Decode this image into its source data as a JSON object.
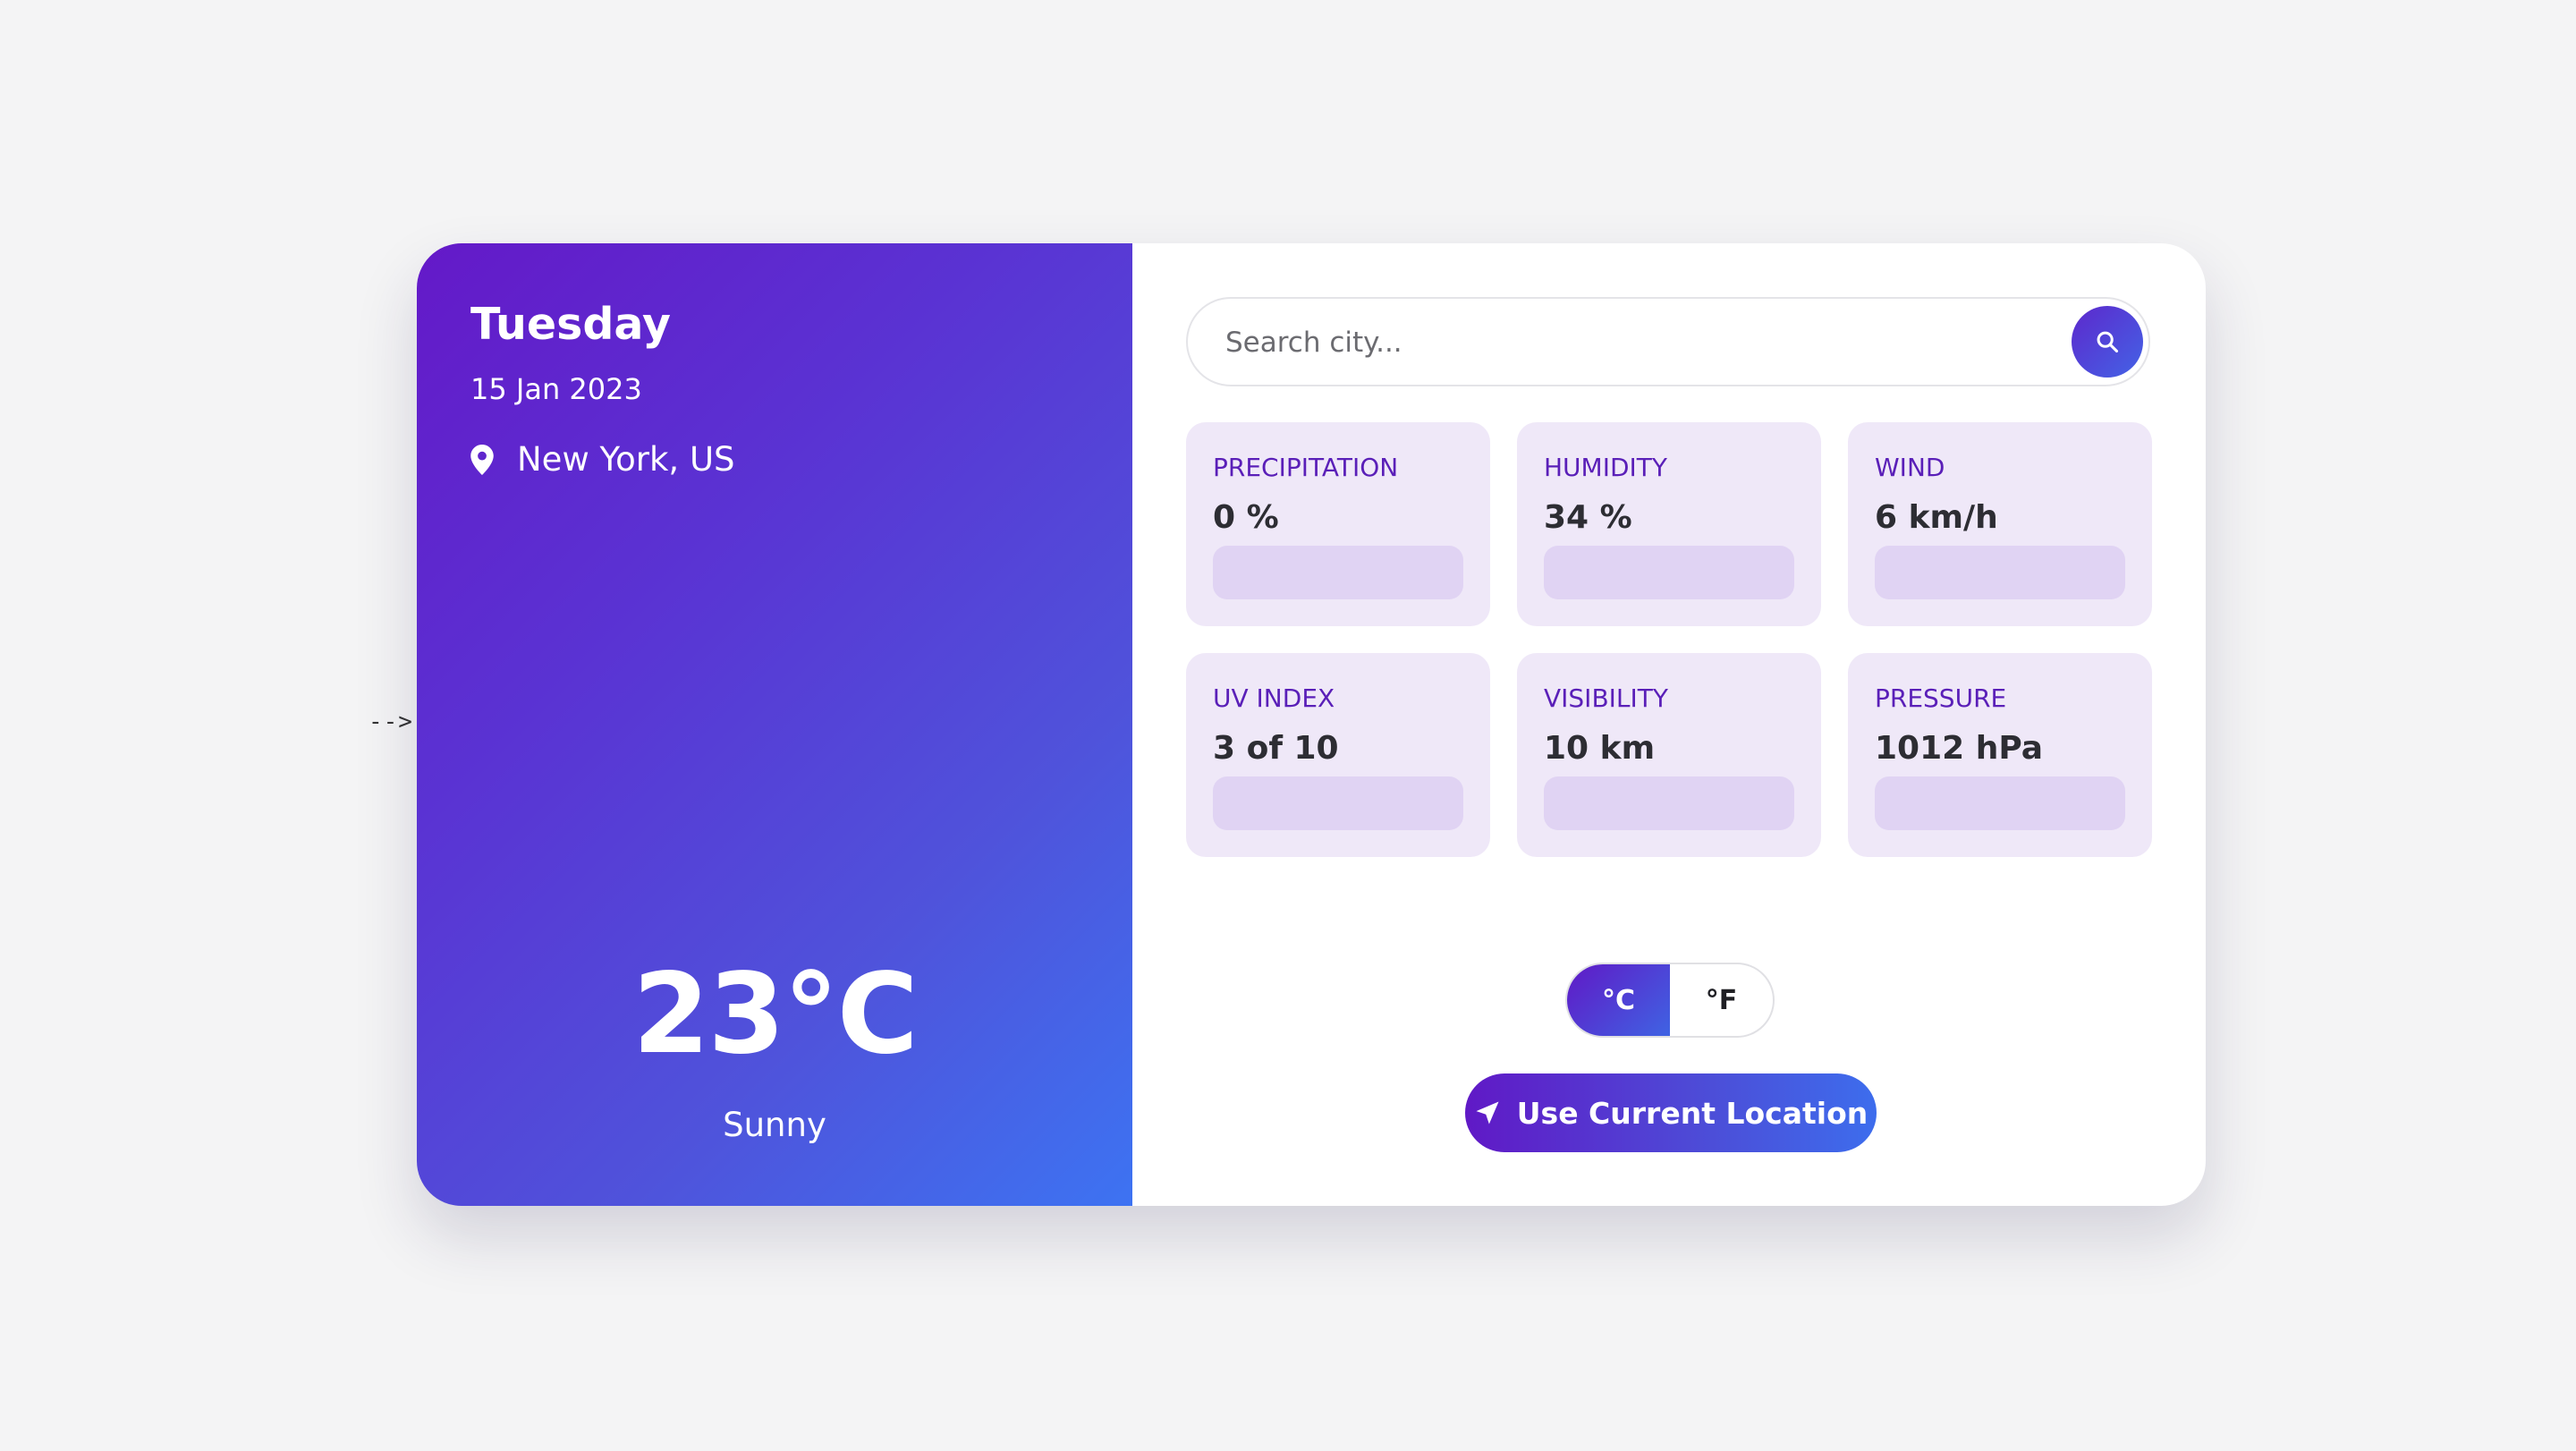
{
  "stray_text": "-->",
  "left_panel": {
    "day": "Tuesday",
    "date": "15 Jan 2023",
    "location": "New York, US",
    "location_icon": "map-pin-icon",
    "temperature": "23°C",
    "condition": "Sunny"
  },
  "search": {
    "placeholder": "Search city...",
    "value": "",
    "icon": "search-icon"
  },
  "stats": [
    {
      "label": "PRECIPITATION",
      "value": "0 %"
    },
    {
      "label": "HUMIDITY",
      "value": "34 %"
    },
    {
      "label": "WIND",
      "value": "6 km/h"
    },
    {
      "label": "UV INDEX",
      "value": "3 of 10"
    },
    {
      "label": "VISIBILITY",
      "value": "10 km"
    },
    {
      "label": "PRESSURE",
      "value": "1012 hPa"
    }
  ],
  "units": {
    "celsius": "°C",
    "fahrenheit": "°F",
    "selected": "celsius"
  },
  "location_button": {
    "label": "Use Current Location",
    "icon": "navigation-arrow-icon"
  },
  "colors": {
    "page_bg": "#f4f4f5",
    "gradient_start": "#6419c8",
    "gradient_end": "#3d73f2",
    "stat_bg": "#efe8f8",
    "stat_label": "#5a1fb8",
    "stat_value": "#2d2d33"
  }
}
